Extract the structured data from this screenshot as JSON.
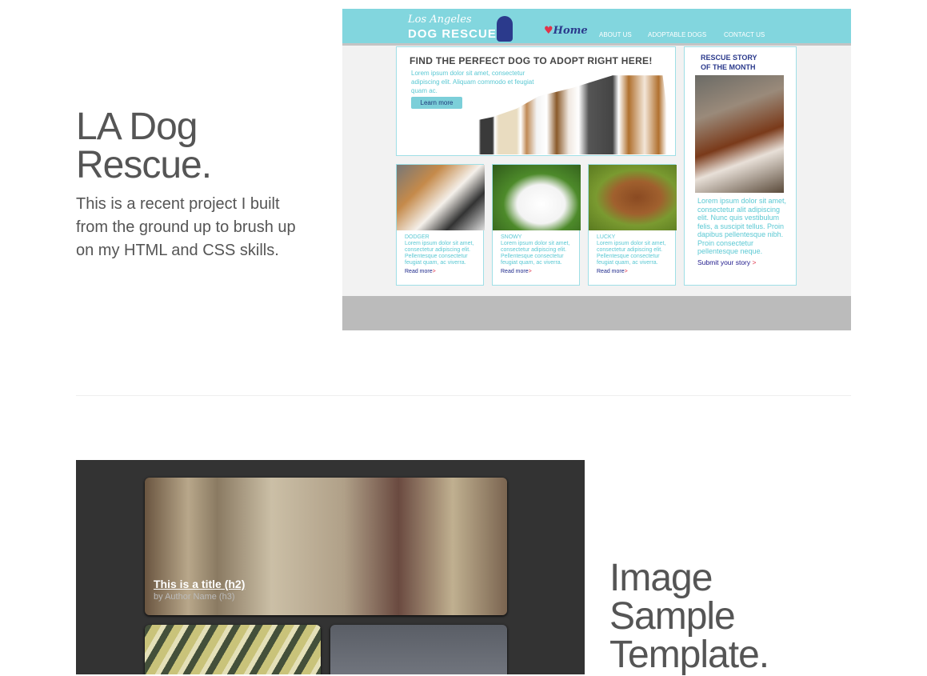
{
  "project1": {
    "title_line1": "LA Dog",
    "title_line2": "Rescue.",
    "description": "This is a recent project I built from the ground up to brush up on my HTML and CSS skills."
  },
  "site": {
    "logo_script": "Los Angeles",
    "logo_main": "DOG RESCUE",
    "nav": {
      "home": "Home",
      "about": "ABOUT US",
      "adoptable": "ADOPTABLE DOGS",
      "contact": "CONTACT US"
    },
    "hero": {
      "heading": "FIND THE PERFECT DOG TO ADOPT RIGHT HERE!",
      "text": "Lorem ipsum dolor sit amet, consectetur adipiscing elit. Aliquam commodo et feugiat quam ac.",
      "button": "Learn more"
    },
    "dogs": [
      {
        "name": "DODGER",
        "text": "Lorem ipsum dolor sit amet, consectetur adipiscing elit. Pellentesque consectetur feugiat quam, ac viverra.",
        "link": "Read more"
      },
      {
        "name": "SNOWY",
        "text": "Lorem ipsum dolor sit amet, consectetur adipiscing elit. Pellentesque consectetur feugiat quam, ac viverra.",
        "link": "Read more"
      },
      {
        "name": "LUCKY",
        "text": "Lorem ipsum dolor sit amet, consectetur adipiscing elit. Pellentesque consectetur feugiat quam, ac viverra.",
        "link": "Read more"
      }
    ],
    "sidebar": {
      "heading_line1": "RESCUE STORY",
      "heading_line2": "OF THE MONTH",
      "text": "Lorem ipsum dolor sit amet, consectetur alit adipiscing elit. Nunc quis vestibulum felis, a suscipit tellus. Proin dapibus pellentesque nibh. Proin consectetur pellentesque neque.",
      "link": "Submit your story"
    },
    "colors": {
      "header": "#82d6de",
      "accent": "#5ac8d3",
      "navy": "#2b3a8c",
      "heart": "#e0334a"
    }
  },
  "project2": {
    "title_line1": "Image",
    "title_line2": "Sample",
    "title_line3": "Template.",
    "card_title": "This is a title (h2)",
    "card_author": "by Author Name (h3)"
  }
}
